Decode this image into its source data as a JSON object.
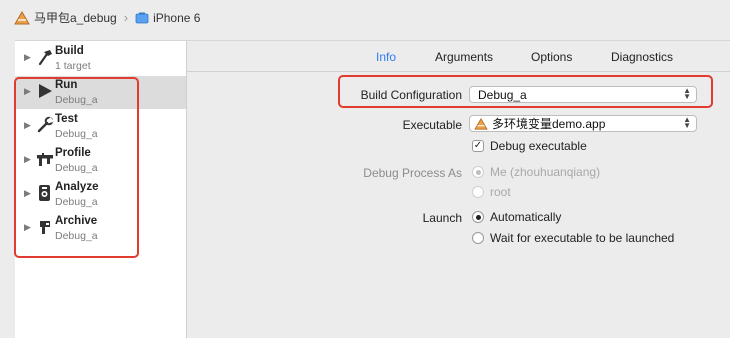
{
  "topbar": {
    "scheme_label": "马甲包a_debug",
    "device_label": "iPhone 6",
    "scheme_icon": "app-target-icon",
    "device_icon": "device-icon"
  },
  "sidebar": {
    "items": [
      {
        "name": "Build",
        "sub": "1 target",
        "icon": "hammer-icon"
      },
      {
        "name": "Run",
        "sub": "Debug_a",
        "icon": "play-icon"
      },
      {
        "name": "Test",
        "sub": "Debug_a",
        "icon": "wrench-icon"
      },
      {
        "name": "Profile",
        "sub": "Debug_a",
        "icon": "caliper-icon"
      },
      {
        "name": "Analyze",
        "sub": "Debug_a",
        "icon": "analyze-icon"
      },
      {
        "name": "Archive",
        "sub": "Debug_a",
        "icon": "archive-icon"
      }
    ]
  },
  "tabs": [
    "Info",
    "Arguments",
    "Options",
    "Diagnostics"
  ],
  "form": {
    "build_config_label": "Build Configuration",
    "build_config_value": "Debug_a",
    "executable_label": "Executable",
    "executable_value": "多环境变量demo.app",
    "debug_executable_label": "Debug executable",
    "debug_process_label": "Debug Process As",
    "debug_process_me": "Me (zhouhuanqiang)",
    "debug_process_root": "root",
    "launch_label": "Launch",
    "launch_auto": "Automatically",
    "launch_wait": "Wait for executable to be launched"
  },
  "colors": {
    "accent": "#2f7bf5",
    "highlight": "#e23b30"
  }
}
